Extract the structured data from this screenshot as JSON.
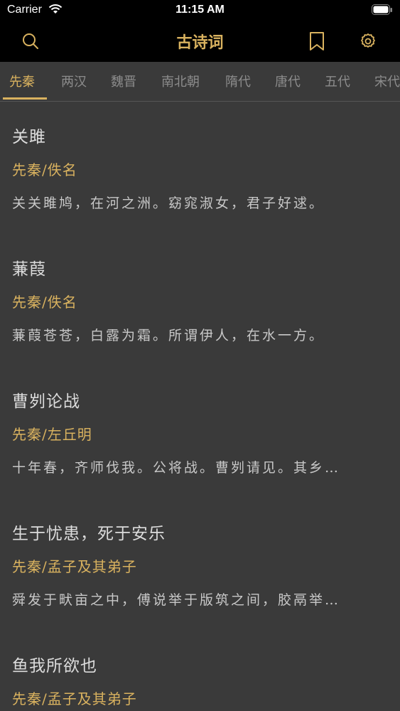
{
  "status_bar": {
    "carrier": "Carrier",
    "time": "11:15 AM"
  },
  "nav": {
    "title": "古诗词",
    "icons": [
      "search-icon",
      "bookmark-icon",
      "settings-icon"
    ],
    "accent_color": "#d9b25f"
  },
  "tabs": [
    {
      "label": "先秦",
      "active": true
    },
    {
      "label": "两汉",
      "active": false
    },
    {
      "label": "魏晋",
      "active": false
    },
    {
      "label": "南北朝",
      "active": false
    },
    {
      "label": "隋代",
      "active": false
    },
    {
      "label": "唐代",
      "active": false
    },
    {
      "label": "五代",
      "active": false
    },
    {
      "label": "宋代",
      "active": false
    }
  ],
  "poems": [
    {
      "title": "关雎",
      "author": "先秦/佚名",
      "excerpt": "关关雎鸠，在河之洲。窈窕淑女，君子好逑。"
    },
    {
      "title": "蒹葭",
      "author": "先秦/佚名",
      "excerpt": "蒹葭苍苍，白露为霜。所谓伊人，在水一方。"
    },
    {
      "title": "曹刿论战",
      "author": "先秦/左丘明",
      "excerpt": "十年春，齐师伐我。公将战。曹刿请见。其乡…"
    },
    {
      "title": "生于忧患，死于安乐",
      "author": "先秦/孟子及其弟子",
      "excerpt": "舜发于畎亩之中，傅说举于版筑之间，胶鬲举…"
    },
    {
      "title": "鱼我所欲也",
      "author": "先秦/孟子及其弟子",
      "excerpt": ""
    }
  ]
}
